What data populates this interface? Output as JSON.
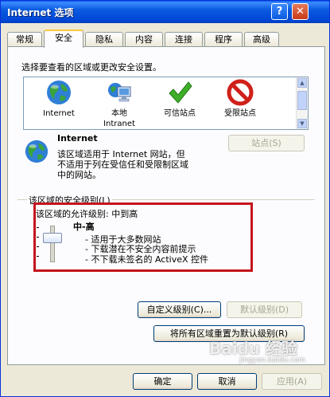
{
  "window": {
    "title": "Internet 选项",
    "help_glyph": "?",
    "close_glyph": "✕"
  },
  "tabs": [
    {
      "label": "常规"
    },
    {
      "label": "安全"
    },
    {
      "label": "隐私"
    },
    {
      "label": "内容"
    },
    {
      "label": "连接"
    },
    {
      "label": "程序"
    },
    {
      "label": "高级"
    }
  ],
  "active_tab": "安全",
  "zones_prompt": "选择要查看的区域或更改安全设置。",
  "zones": [
    {
      "label1": "Internet",
      "label2": "",
      "icon": "globe-icon"
    },
    {
      "label1": "本地",
      "label2": "Intranet",
      "icon": "intranet-icon"
    },
    {
      "label1": "可信站点",
      "label2": "",
      "icon": "checkmark-icon"
    },
    {
      "label1": "受限站点",
      "label2": "",
      "icon": "restricted-icon"
    }
  ],
  "selected_zone": {
    "name": "Internet",
    "desc1": "该区域适用于 Internet 网站，但",
    "desc2": "不适用于列在受信任和受限制区域",
    "desc3": "中的网站。"
  },
  "sites_button": "站点(S)",
  "security_level": {
    "group_label": "该区域的安全级别(L)",
    "allowed_label": "该区域的允许级别: 中到高",
    "level_name": "中-高",
    "bullets": [
      "- 适用于大多数网站",
      "- 下载潜在不安全内容前提示",
      "- 不下载未签名的 ActiveX 控件"
    ]
  },
  "buttons": {
    "custom_level": "自定义级别(C)...",
    "default_level": "默认级别(D)",
    "reset_all": "将所有区域重置为默认级别(R)",
    "ok": "确定",
    "cancel": "取消",
    "apply": "应用(A)"
  },
  "watermark": {
    "main": "Baidu 经验",
    "sub": "jingyan.baidu.com"
  },
  "colors": {
    "title_bar": "#0a5ae0",
    "highlight_box": "#c4141c",
    "tab_active_top": "#ffc83c"
  }
}
